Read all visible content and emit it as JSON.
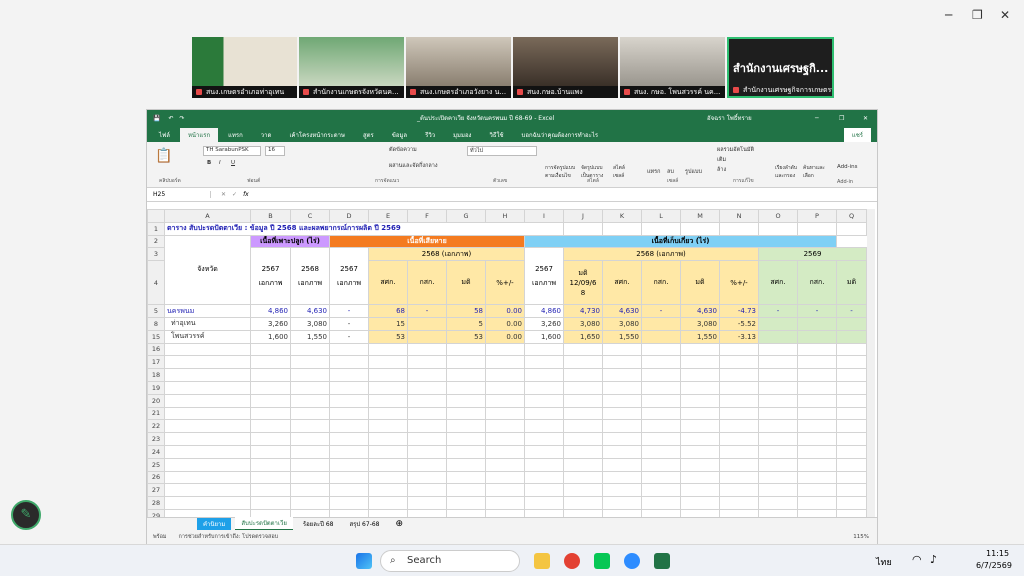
{
  "participants": [
    {
      "name": "สนง.เกษตรอำเภอท่าอุเทน"
    },
    {
      "name": "สำนักงานเกษตรจังหวัดนค..."
    },
    {
      "name": "สนง.เกษตรอำเภอวังยาง น..."
    },
    {
      "name": "สนง.กษอ.บ้านแพง"
    },
    {
      "name": "สนง. กษอ. โพนสวรรค์ นค..."
    },
    {
      "name": "สำนักงานเศรษฐกิจการเกษตรที่..."
    }
  ],
  "presenter_title": "สำนักงานเศรษฐกิ...",
  "excel": {
    "doc_title": "_ต้นประเปิดคาเวีย จังหวัดนครพนม ปี 68-69 - Excel",
    "user": "อัจฉรา โพธิ์ทราย",
    "share_label": "แชร์",
    "tabs": [
      "ไฟล์",
      "หน้าแรก",
      "แทรก",
      "วาด",
      "เค้าโครงหน้ากระดาษ",
      "สูตร",
      "ข้อมูล",
      "รีวิว",
      "มุมมอง",
      "วิธีใช้",
      "บอกฉันว่าคุณต้องการทำอะไร"
    ],
    "font_name": "TH SarabunPSK",
    "font_size": "16",
    "number_format": "ทั่วไป",
    "cell_ref": "H25",
    "ribbon_groups": [
      "คลิปบอร์ด",
      "ฟอนต์",
      "การจัดแนว",
      "ตัวเลข",
      "สไตล์",
      "เซลล์",
      "การแก้ไข",
      "Add-in"
    ],
    "ribbon_labels": [
      "ตัดข้อความ",
      "ผสานและจัดกึ่งกลาง",
      "การจัดรูปแบบตามเงื่อนไข",
      "จัดรูปแบบเป็นตาราง",
      "สไตล์เซลล์",
      "แทรก",
      "ลบ",
      "รูปแบบ",
      "ผลรวมอัตโนมัติ",
      "เติม",
      "ล้าง",
      "เรียงลำดับและกรอง",
      "ค้นหาและเลือก",
      "Add-ins"
    ],
    "columns": [
      "A",
      "B",
      "C",
      "D",
      "E",
      "F",
      "G",
      "H",
      "I",
      "J",
      "K",
      "L",
      "M",
      "N",
      "O",
      "P",
      "Q"
    ],
    "row_numbers": [
      "1",
      "2",
      "3",
      "4",
      "5",
      "8",
      "15",
      "16",
      "17",
      "18",
      "19",
      "20",
      "21",
      "22",
      "23",
      "24",
      "25",
      "26",
      "27",
      "28",
      "29"
    ],
    "title_row": "ตาราง สับปะรดปัตตาเวีย  :  ข้อมูล ปี 2568 และผลพยากรณ์การผลิต ปี 2569",
    "h_plant": "เนื้อที่เพาะปลูก (ไร่)",
    "h_damage": "เนื้อที่เสียหาย",
    "h_harvest": "เนื้อที่เก็บเกี่ยว (ไร่)",
    "h_province": "จังหวัด",
    "h_2568_gov": "2568 (เอกภาพ)",
    "h_2569": "2569",
    "h_b": [
      "2567",
      "เอกภาพ"
    ],
    "h_c": [
      "2568",
      "เอกภาพ"
    ],
    "h_d": [
      "2567",
      "เอกภาพ"
    ],
    "h_i": [
      "2567",
      "เอกภาพ"
    ],
    "h_j": [
      "มติ",
      "12/09/6",
      "8"
    ],
    "sub_e": "สศก.",
    "sub_f": "กสก.",
    "sub_g": "มติ",
    "sub_h": "%+/-",
    "sub_k": "สศก.",
    "sub_l": "กสก.",
    "sub_m": "มติ",
    "sub_n": "%+/-",
    "sub_o": "สศก.",
    "sub_p": "กสก.",
    "sub_q": "มติ",
    "rows": [
      {
        "a": "นครพนม",
        "b": "4,860",
        "c": "4,630",
        "d": "-",
        "e": "68",
        "f": "-",
        "g": "58",
        "h": "0.00",
        "i": "4,860",
        "j": "4,730",
        "k": "4,630",
        "l": "-",
        "m": "4,630",
        "n": "-4.73",
        "o": "-",
        "p": "-",
        "q": "-"
      },
      {
        "a": "ท่าอุเทน",
        "b": "3,260",
        "c": "3,080",
        "d": "-",
        "e": "15",
        "f": "",
        "g": "5",
        "h": "0.00",
        "i": "3,260",
        "j": "3,080",
        "k": "3,080",
        "l": "",
        "m": "3,080",
        "n": "-5.52",
        "o": "",
        "p": "",
        "q": ""
      },
      {
        "a": "โพนสวรรค์",
        "b": "1,600",
        "c": "1,550",
        "d": "-",
        "e": "53",
        "f": "",
        "g": "53",
        "h": "0.00",
        "i": "1,600",
        "j": "1,650",
        "k": "1,550",
        "l": "",
        "m": "1,550",
        "n": "-3.13",
        "o": "",
        "p": "",
        "q": ""
      }
    ],
    "sheet_tabs": [
      "คำนิยาม",
      "สับปะรดปัตตาเวีย",
      "ร้อยละปี 68",
      "สรุป 67-68"
    ],
    "status_ready": "พร้อม",
    "status_access": "การช่วยสำหรับการเข้าถึง: โปรดตรวจสอบ",
    "zoom": "115%"
  },
  "taskbar": {
    "search": "Search",
    "lang": "ไทย",
    "time": "11:15",
    "date": "6/7/2569"
  },
  "colors": {
    "excel_green": "#217346",
    "purple": "#cc99ff",
    "orange": "#f47b20",
    "blue": "#7fd0f5",
    "yellow": "#ffe8a6",
    "green": "#d4ebc4",
    "navy": "#1f1fb3"
  }
}
